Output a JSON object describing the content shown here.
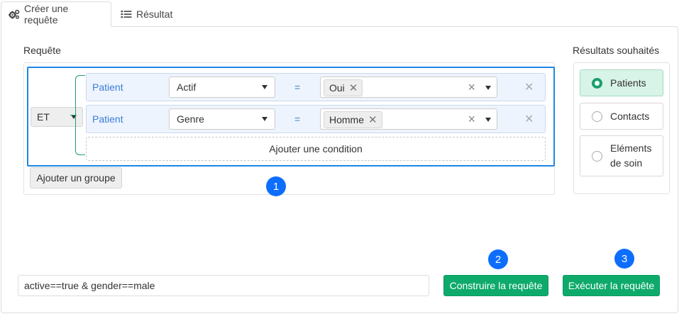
{
  "tabs": [
    {
      "label": "Créer une requête",
      "icon": "gears-icon",
      "active": true
    },
    {
      "label": "Résultat",
      "icon": "list-icon",
      "active": false
    }
  ],
  "query": {
    "section_label": "Requête",
    "group_operator": "ET",
    "conditions": [
      {
        "entity": "Patient",
        "field": "Actif",
        "operator": "=",
        "value": "Oui"
      },
      {
        "entity": "Patient",
        "field": "Genre",
        "operator": "=",
        "value": "Homme"
      }
    ],
    "add_condition_label": "Ajouter une condition",
    "add_group_label": "Ajouter un groupe"
  },
  "results": {
    "section_label": "Résultats souhaités",
    "options": [
      {
        "label": "Patients",
        "selected": true
      },
      {
        "label": "Contacts",
        "selected": false
      },
      {
        "label_line1": "Eléments",
        "label_line2": "de soin",
        "selected": false
      }
    ]
  },
  "query_string": "active==true & gender==male",
  "buttons": {
    "build_label": "Construire la requête",
    "execute_label": "Exécuter la requête"
  },
  "badges": [
    "1",
    "2",
    "3"
  ],
  "colors": {
    "accent_blue": "#1e88e5",
    "badge_blue": "#0d6efd",
    "green": "#0eaa6c",
    "selected_bg": "#d8f3e7"
  }
}
